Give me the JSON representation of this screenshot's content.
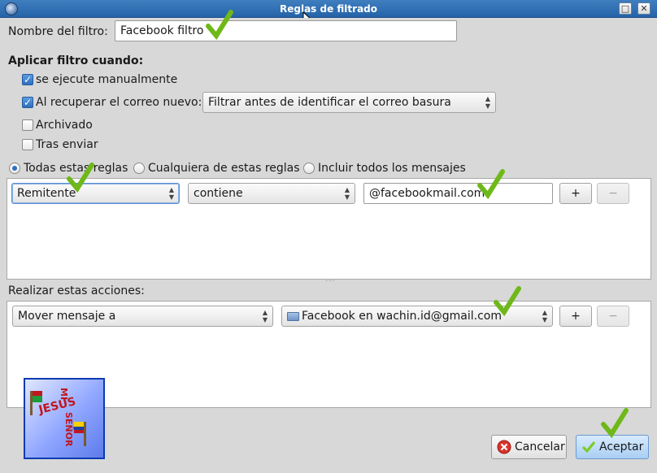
{
  "window": {
    "title": "Reglas de filtrado"
  },
  "filter_name": {
    "label": "Nombre del filtro:",
    "value": "Facebook filtro"
  },
  "apply_when": {
    "heading": "Aplicar filtro cuando:",
    "manual_label": "se ejecute manualmente",
    "manual_checked": true,
    "on_fetch_label": "Al recuperar el correo nuevo:",
    "on_fetch_checked": true,
    "on_fetch_option": "Filtrar antes de identificar el correo basura",
    "archive_label": "Archivado",
    "archive_checked": false,
    "after_send_label": "Tras enviar",
    "after_send_checked": false
  },
  "match_mode": {
    "all_label": "Todas estas reglas",
    "any_label": "Cualquiera de estas reglas",
    "every_label": "Incluir todos los mensajes",
    "selected": "all"
  },
  "rule": {
    "field": "Remitente",
    "operator": "contiene",
    "value": "@facebookmail.com",
    "add_label": "+",
    "remove_label": "−"
  },
  "actions": {
    "heading": "Realizar estas acciones:",
    "action": "Mover mensaje a",
    "target": "Facebook en wachin.id@gmail.com",
    "add_label": "+",
    "remove_label": "−"
  },
  "buttons": {
    "cancel": "Cancelar",
    "accept": "Aceptar"
  },
  "logo": {
    "words": [
      "MI",
      "JESÚS",
      "SEÑOR"
    ]
  },
  "colors": {
    "titlebar": "#2f6fb4",
    "checkmark": "#7ccb1e",
    "cancel_icon": "#d9342b"
  }
}
